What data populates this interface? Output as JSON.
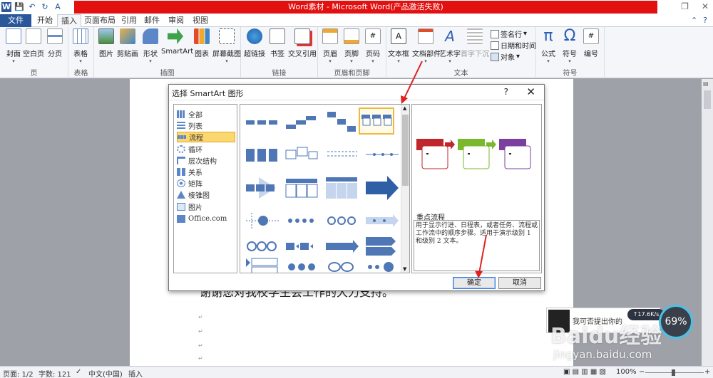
{
  "window": {
    "title": "Word素材 - Microsoft Word(产品激活失败)",
    "qat": [
      "W",
      "💾",
      "↶",
      "↻",
      "A"
    ]
  },
  "tabs": [
    "文件",
    "开始",
    "插入",
    "页面布局",
    "引用",
    "邮件",
    "审阅",
    "视图"
  ],
  "ribbon": {
    "groups": {
      "page": {
        "label": "页",
        "buttons": [
          "封面",
          "空白页",
          "分页"
        ]
      },
      "table": {
        "label": "表格",
        "buttons": [
          "表格"
        ]
      },
      "illustrations": {
        "label": "插图",
        "buttons": [
          "图片",
          "剪贴画",
          "形状",
          "SmartArt",
          "图表",
          "屏幕截图"
        ]
      },
      "links": {
        "label": "链接",
        "buttons": [
          "超链接",
          "书签",
          "交叉引用"
        ]
      },
      "header_footer": {
        "label": "页眉和页脚",
        "buttons": [
          "页眉",
          "页脚",
          "页码"
        ]
      },
      "text": {
        "label": "文本",
        "buttons": [
          "文本框",
          "文档部件",
          "艺术字",
          "首字下沉"
        ],
        "small": [
          "签名行",
          "日期和时间",
          "对象"
        ]
      },
      "symbols": {
        "label": "符号",
        "buttons": [
          "公式",
          "符号",
          "编号"
        ]
      }
    }
  },
  "document": {
    "text_line": "谢谢您对我校学生会工作的大力支持。",
    "para_mark": "↵"
  },
  "dialog": {
    "title": "选择 SmartArt 图形",
    "help": "?",
    "close": "✕",
    "categories": [
      "全部",
      "列表",
      "流程",
      "循环",
      "层次结构",
      "关系",
      "矩阵",
      "棱锥图",
      "图片",
      "Office.com"
    ],
    "selected_category": "流程",
    "preview_name": "重点流程",
    "preview_desc": "用于显示行进、日程表，或者任务、流程或工作流中的顺序步骤。适用于演示级别 1 和级别 2 文本。",
    "ok": "确定",
    "cancel": "取消"
  },
  "status": {
    "page": "页面: 1/2",
    "words": "字数: 121",
    "lang": "中文(中国)",
    "mode": "插入",
    "zoom": "100%"
  },
  "overlay": {
    "notif_text": "我可否提出你的",
    "speed": "↑17.6K/s",
    "gauge": "69%",
    "watermark": "Baidu经验",
    "watermark_url": "jingyan.baidu.com"
  }
}
